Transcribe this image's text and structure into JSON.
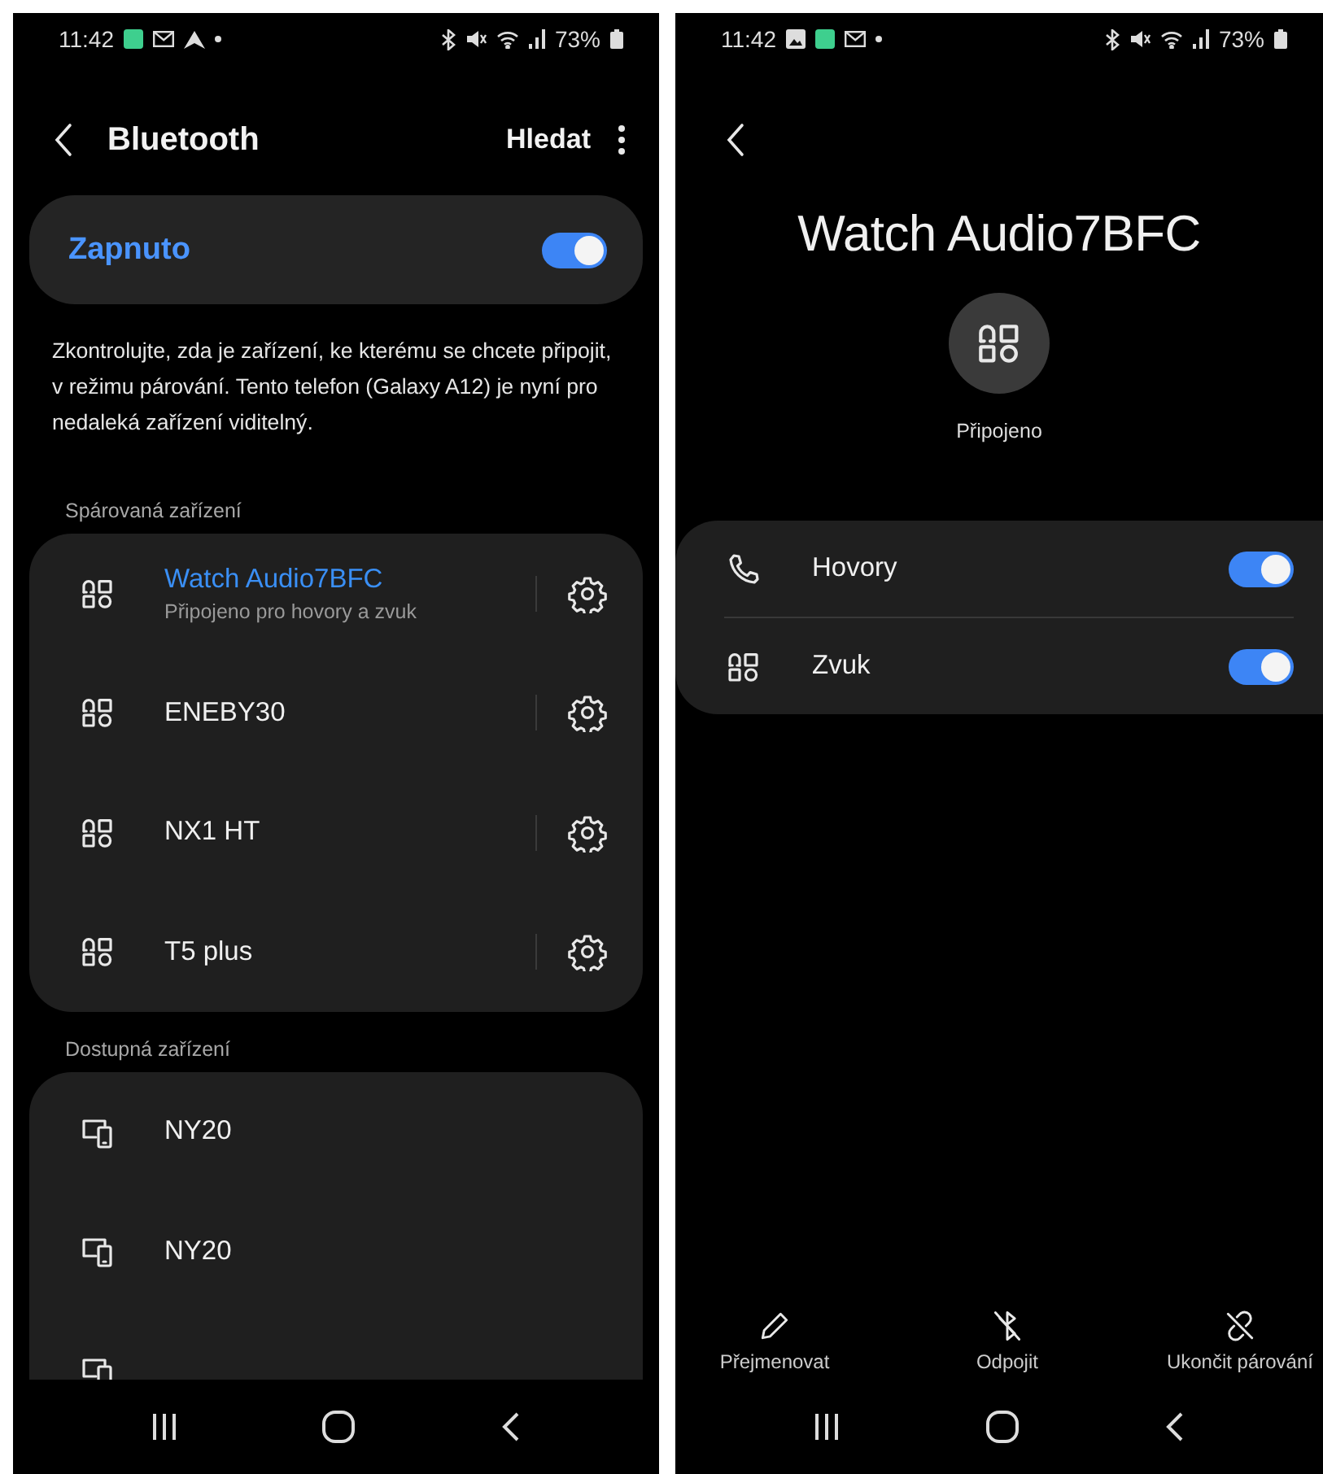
{
  "bluetooth_screen": {
    "status_bar": {
      "time": "11:42",
      "icons": [
        {
          "kind": "app"
        },
        {
          "kind": "mail"
        },
        {
          "kind": "navigation"
        }
      ],
      "battery": "73%"
    },
    "header": {
      "title": "Bluetooth",
      "action": "Hledat"
    },
    "master_switch": {
      "label": "Zapnuto",
      "on": true
    },
    "description": "Zkontrolujte, zda je zařízení, ke kterému se chcete připojit, v režimu párování. Tento telefon (Galaxy A12) je nyní pro nedaleká zařízení viditelný.",
    "paired": {
      "heading": "Spárovaná zařízení",
      "devices": [
        {
          "name": "Watch Audio7BFC",
          "subtitle": "Připojeno pro hovory a zvuk",
          "connected": true
        },
        {
          "name": "ENEBY30",
          "connected": false
        },
        {
          "name": "NX1 HT",
          "connected": false
        },
        {
          "name": "T5 plus",
          "connected": false
        }
      ]
    },
    "available": {
      "heading": "Dostupná zařízení",
      "devices": [
        {
          "name": "NY20"
        },
        {
          "name": "NY20"
        }
      ]
    }
  },
  "device_screen": {
    "status_bar": {
      "time": "11:42",
      "icons": [
        {
          "kind": "image"
        },
        {
          "kind": "app"
        },
        {
          "kind": "mail"
        }
      ],
      "battery": "73%"
    },
    "title": "Watch Audio7BFC",
    "status": "Připojeno",
    "profiles": [
      {
        "kind": "calls",
        "label": "Hovory",
        "on": true
      },
      {
        "kind": "audio",
        "label": "Zvuk",
        "on": true
      }
    ],
    "actions": [
      {
        "kind": "rename",
        "label": "Přejmenovat"
      },
      {
        "kind": "disconnect",
        "label": "Odpojit"
      },
      {
        "kind": "unpair",
        "label": "Ukončit párování"
      }
    ]
  }
}
